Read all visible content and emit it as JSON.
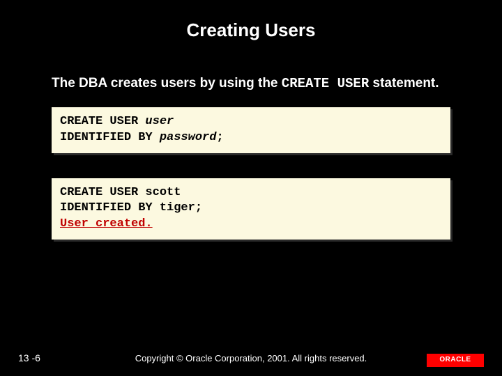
{
  "title": "Creating Users",
  "body": {
    "prefix": "The DBA creates users by using the ",
    "keyword": "CREATE USER",
    "suffix": " statement."
  },
  "code1": {
    "line1_cmd": "CREATE USER ",
    "line1_param": "user",
    "line2_cmd": "IDENTIFIED BY   ",
    "line2_param": "password",
    "line2_tail": ";"
  },
  "code2": {
    "line1": "CREATE USER  scott",
    "line2": "IDENTIFIED BY   tiger;",
    "feedback": "User created."
  },
  "footer": {
    "page": "13 -6",
    "copyright": "Copyright © Oracle Corporation, 2001. All rights reserved.",
    "logo_text": "ORACLE"
  }
}
